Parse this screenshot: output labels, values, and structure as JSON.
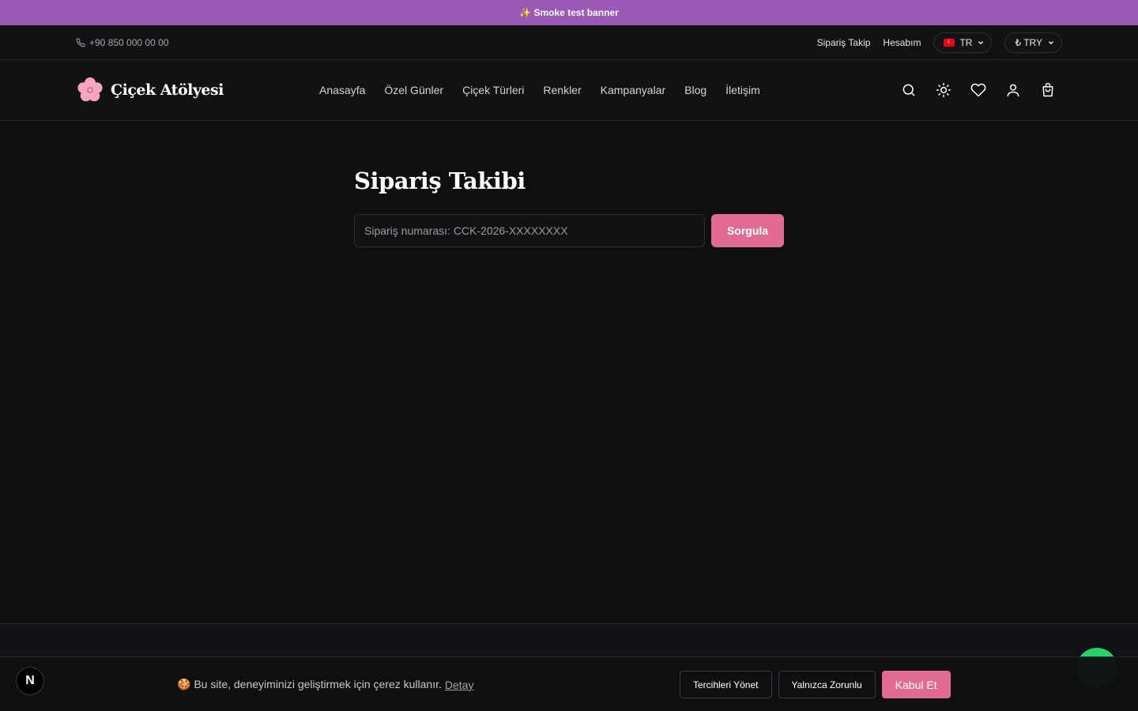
{
  "banner": {
    "text": "✨ Smoke test banner"
  },
  "topbar": {
    "phone": "+90 850 000 00 00",
    "links": [
      "Sipariş Takip",
      "Hesabım"
    ],
    "language": "TR",
    "currency": "₺ TRY"
  },
  "header": {
    "logo_text": "Çiçek Atölyesi",
    "nav": [
      "Anasayfa",
      "Özel Günler",
      "Çiçek Türleri",
      "Renkler",
      "Kampanyalar",
      "Blog",
      "İletişim"
    ],
    "icons": [
      "search-icon",
      "theme-toggle-icon",
      "heart-icon",
      "user-icon",
      "bag-icon"
    ]
  },
  "main": {
    "title": "Sipariş Takibi",
    "input_placeholder": "Sipariş numarası: CCK-2026-XXXXXXXX",
    "submit_label": "Sorgula"
  },
  "cookie": {
    "message": "🍪 Bu site, deneyiminizi geliştirmek için çerez kullanır.",
    "detail_link": "Detay",
    "manage_label": "Tercihleri Yönet",
    "necessary_label": "Yalnızca Zorunlu",
    "accept_label": "Kabul Et"
  },
  "dev_badge": "N",
  "colors": {
    "accent": "#e26b92",
    "banner": "#9b59b6",
    "background": "#0f0f12"
  }
}
